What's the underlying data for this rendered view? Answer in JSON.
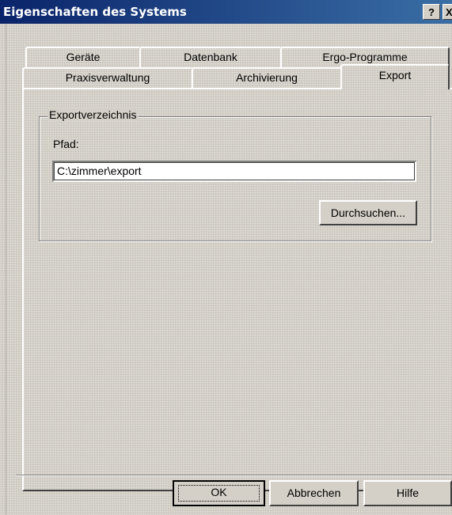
{
  "window": {
    "title": "Eigenschaften des Systems",
    "help_glyph": "?",
    "close_glyph": "X"
  },
  "tabs": {
    "row1": [
      "Geräte",
      "Datenbank",
      "Ergo-Programme"
    ],
    "row2": [
      "Praxisverwaltung",
      "Archivierung",
      "Export"
    ],
    "active": "Export"
  },
  "export_group": {
    "legend": "Exportverzeichnis",
    "path_label": "Pfad:",
    "path_value": "C:\\zimmer\\export",
    "browse_label": "Durchsuchen..."
  },
  "buttons": {
    "ok": "OK",
    "cancel": "Abbrechen",
    "help": "Hilfe"
  },
  "colors": {
    "face": "#d4d0c8",
    "titlebar_start": "#0a246a",
    "titlebar_end": "#3a6ea5"
  }
}
